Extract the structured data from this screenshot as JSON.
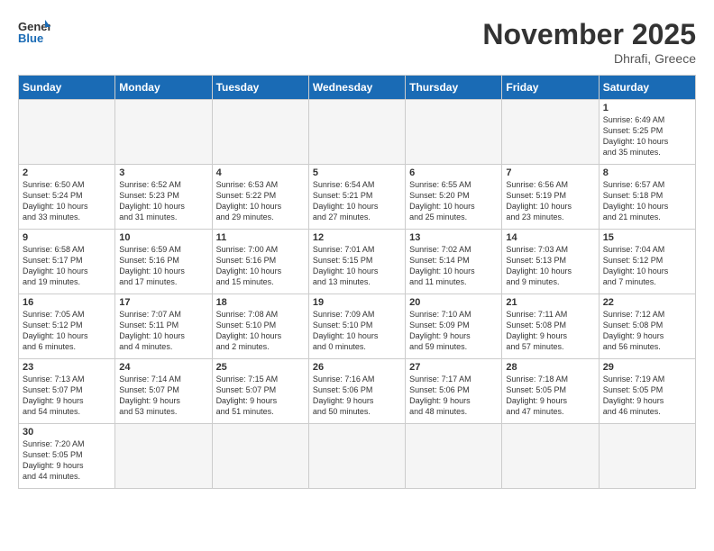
{
  "header": {
    "logo_general": "General",
    "logo_blue": "Blue",
    "month_title": "November 2025",
    "location": "Dhrafi, Greece"
  },
  "weekdays": [
    "Sunday",
    "Monday",
    "Tuesday",
    "Wednesday",
    "Thursday",
    "Friday",
    "Saturday"
  ],
  "days": [
    {
      "num": "",
      "info": ""
    },
    {
      "num": "",
      "info": ""
    },
    {
      "num": "",
      "info": ""
    },
    {
      "num": "",
      "info": ""
    },
    {
      "num": "",
      "info": ""
    },
    {
      "num": "",
      "info": ""
    },
    {
      "num": "1",
      "info": "Sunrise: 6:49 AM\nSunset: 5:25 PM\nDaylight: 10 hours\nand 35 minutes."
    },
    {
      "num": "2",
      "info": "Sunrise: 6:50 AM\nSunset: 5:24 PM\nDaylight: 10 hours\nand 33 minutes."
    },
    {
      "num": "3",
      "info": "Sunrise: 6:52 AM\nSunset: 5:23 PM\nDaylight: 10 hours\nand 31 minutes."
    },
    {
      "num": "4",
      "info": "Sunrise: 6:53 AM\nSunset: 5:22 PM\nDaylight: 10 hours\nand 29 minutes."
    },
    {
      "num": "5",
      "info": "Sunrise: 6:54 AM\nSunset: 5:21 PM\nDaylight: 10 hours\nand 27 minutes."
    },
    {
      "num": "6",
      "info": "Sunrise: 6:55 AM\nSunset: 5:20 PM\nDaylight: 10 hours\nand 25 minutes."
    },
    {
      "num": "7",
      "info": "Sunrise: 6:56 AM\nSunset: 5:19 PM\nDaylight: 10 hours\nand 23 minutes."
    },
    {
      "num": "8",
      "info": "Sunrise: 6:57 AM\nSunset: 5:18 PM\nDaylight: 10 hours\nand 21 minutes."
    },
    {
      "num": "9",
      "info": "Sunrise: 6:58 AM\nSunset: 5:17 PM\nDaylight: 10 hours\nand 19 minutes."
    },
    {
      "num": "10",
      "info": "Sunrise: 6:59 AM\nSunset: 5:16 PM\nDaylight: 10 hours\nand 17 minutes."
    },
    {
      "num": "11",
      "info": "Sunrise: 7:00 AM\nSunset: 5:16 PM\nDaylight: 10 hours\nand 15 minutes."
    },
    {
      "num": "12",
      "info": "Sunrise: 7:01 AM\nSunset: 5:15 PM\nDaylight: 10 hours\nand 13 minutes."
    },
    {
      "num": "13",
      "info": "Sunrise: 7:02 AM\nSunset: 5:14 PM\nDaylight: 10 hours\nand 11 minutes."
    },
    {
      "num": "14",
      "info": "Sunrise: 7:03 AM\nSunset: 5:13 PM\nDaylight: 10 hours\nand 9 minutes."
    },
    {
      "num": "15",
      "info": "Sunrise: 7:04 AM\nSunset: 5:12 PM\nDaylight: 10 hours\nand 7 minutes."
    },
    {
      "num": "16",
      "info": "Sunrise: 7:05 AM\nSunset: 5:12 PM\nDaylight: 10 hours\nand 6 minutes."
    },
    {
      "num": "17",
      "info": "Sunrise: 7:07 AM\nSunset: 5:11 PM\nDaylight: 10 hours\nand 4 minutes."
    },
    {
      "num": "18",
      "info": "Sunrise: 7:08 AM\nSunset: 5:10 PM\nDaylight: 10 hours\nand 2 minutes."
    },
    {
      "num": "19",
      "info": "Sunrise: 7:09 AM\nSunset: 5:10 PM\nDaylight: 10 hours\nand 0 minutes."
    },
    {
      "num": "20",
      "info": "Sunrise: 7:10 AM\nSunset: 5:09 PM\nDaylight: 9 hours\nand 59 minutes."
    },
    {
      "num": "21",
      "info": "Sunrise: 7:11 AM\nSunset: 5:08 PM\nDaylight: 9 hours\nand 57 minutes."
    },
    {
      "num": "22",
      "info": "Sunrise: 7:12 AM\nSunset: 5:08 PM\nDaylight: 9 hours\nand 56 minutes."
    },
    {
      "num": "23",
      "info": "Sunrise: 7:13 AM\nSunset: 5:07 PM\nDaylight: 9 hours\nand 54 minutes."
    },
    {
      "num": "24",
      "info": "Sunrise: 7:14 AM\nSunset: 5:07 PM\nDaylight: 9 hours\nand 53 minutes."
    },
    {
      "num": "25",
      "info": "Sunrise: 7:15 AM\nSunset: 5:07 PM\nDaylight: 9 hours\nand 51 minutes."
    },
    {
      "num": "26",
      "info": "Sunrise: 7:16 AM\nSunset: 5:06 PM\nDaylight: 9 hours\nand 50 minutes."
    },
    {
      "num": "27",
      "info": "Sunrise: 7:17 AM\nSunset: 5:06 PM\nDaylight: 9 hours\nand 48 minutes."
    },
    {
      "num": "28",
      "info": "Sunrise: 7:18 AM\nSunset: 5:05 PM\nDaylight: 9 hours\nand 47 minutes."
    },
    {
      "num": "29",
      "info": "Sunrise: 7:19 AM\nSunset: 5:05 PM\nDaylight: 9 hours\nand 46 minutes."
    },
    {
      "num": "30",
      "info": "Sunrise: 7:20 AM\nSunset: 5:05 PM\nDaylight: 9 hours\nand 44 minutes."
    },
    {
      "num": "",
      "info": ""
    },
    {
      "num": "",
      "info": ""
    },
    {
      "num": "",
      "info": ""
    },
    {
      "num": "",
      "info": ""
    },
    {
      "num": "",
      "info": ""
    },
    {
      "num": "",
      "info": ""
    }
  ]
}
